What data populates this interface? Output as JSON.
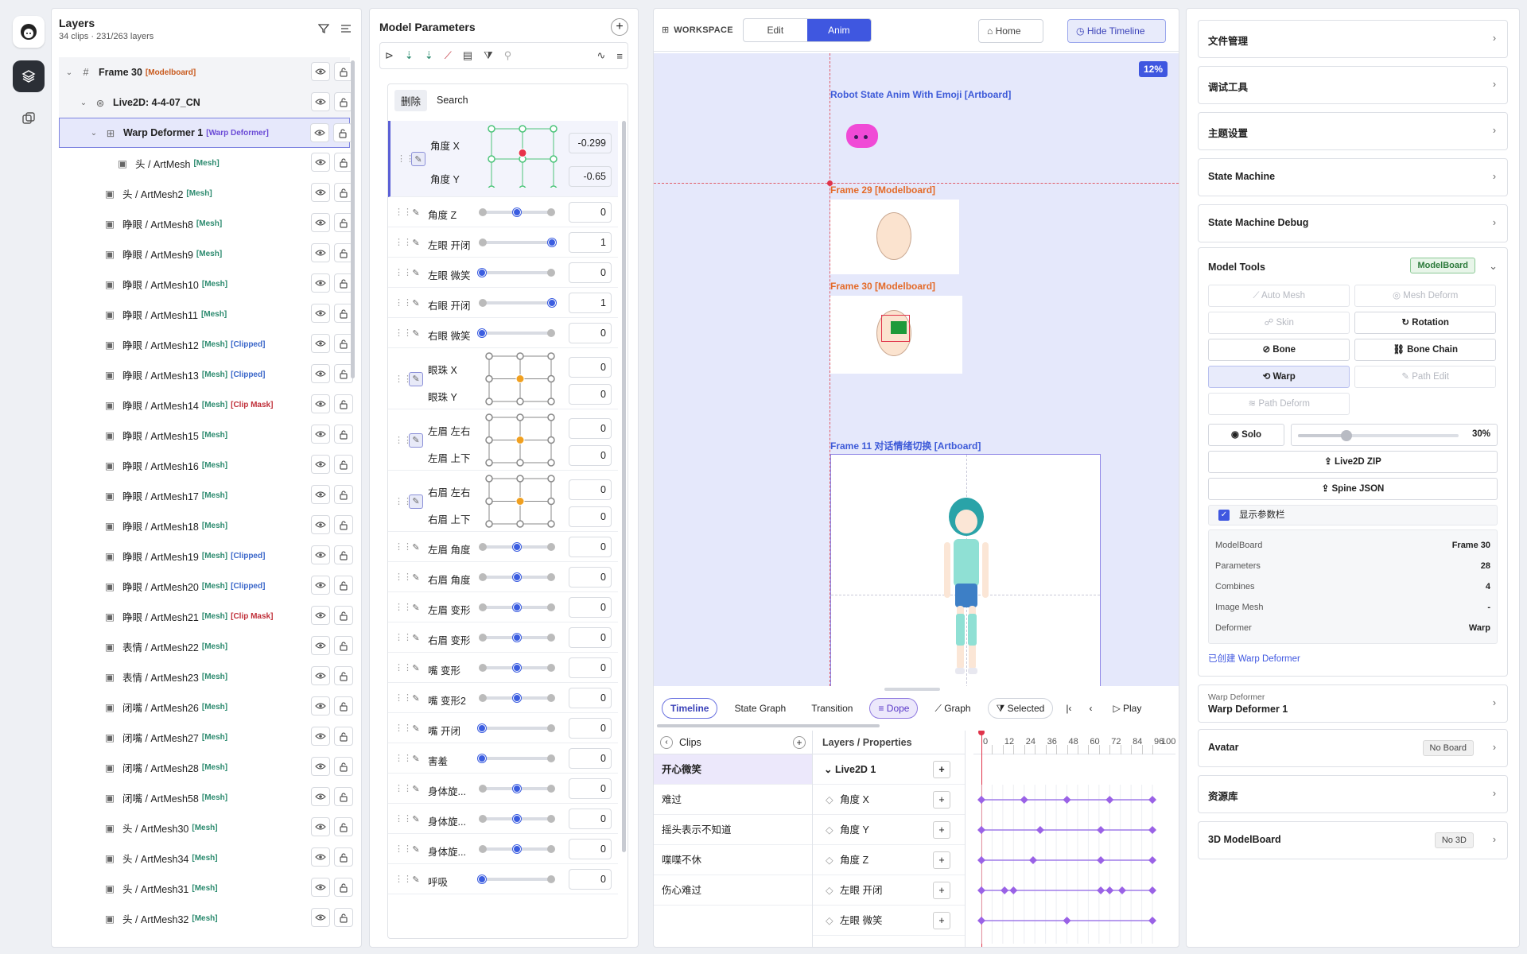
{
  "layers": {
    "title": "Layers",
    "subtitle": "34 clips · 231/263 layers",
    "rows": [
      {
        "name": "Frame 30",
        "tag": "[Modelboard]",
        "tag2": "",
        "kind": "frame",
        "indent": 0,
        "chev": "⌄"
      },
      {
        "name": "Live2D: 4-4-07_CN",
        "tag": "",
        "tag2": "",
        "kind": "l2d",
        "indent": 1,
        "chev": "⌄"
      },
      {
        "name": "Warp Deformer 1",
        "tag": "[Warp Deformer]",
        "tag2": "",
        "kind": "warp",
        "indent": 2,
        "chev": "⌄"
      },
      {
        "name": "头 / ArtMesh",
        "tag": "[Mesh]",
        "tag2": "",
        "kind": "mesh",
        "indent": 3,
        "chev": ""
      },
      {
        "name": "头 / ArtMesh2",
        "tag": "[Mesh]",
        "tag2": "",
        "kind": "mesh",
        "indent": 2,
        "chev": ""
      },
      {
        "name": "睁眼 / ArtMesh8",
        "tag": "[Mesh]",
        "tag2": "",
        "kind": "mesh",
        "indent": 2,
        "chev": ""
      },
      {
        "name": "睁眼 / ArtMesh9",
        "tag": "[Mesh]",
        "tag2": "",
        "kind": "mesh",
        "indent": 2,
        "chev": ""
      },
      {
        "name": "睁眼 / ArtMesh10",
        "tag": "[Mesh]",
        "tag2": "",
        "kind": "mesh",
        "indent": 2,
        "chev": ""
      },
      {
        "name": "睁眼 / ArtMesh11",
        "tag": "[Mesh]",
        "tag2": "",
        "kind": "mesh",
        "indent": 2,
        "chev": ""
      },
      {
        "name": "睁眼 / ArtMesh12",
        "tag": "[Mesh]",
        "tag2": "[Clipped]",
        "kind": "mesh",
        "indent": 2,
        "chev": ""
      },
      {
        "name": "睁眼 / ArtMesh13",
        "tag": "[Mesh]",
        "tag2": "[Clipped]",
        "kind": "mesh",
        "indent": 2,
        "chev": ""
      },
      {
        "name": "睁眼 / ArtMesh14",
        "tag": "[Mesh]",
        "tag2": "[Clip Mask]",
        "kind": "mesh",
        "indent": 2,
        "chev": ""
      },
      {
        "name": "睁眼 / ArtMesh15",
        "tag": "[Mesh]",
        "tag2": "",
        "kind": "mesh",
        "indent": 2,
        "chev": ""
      },
      {
        "name": "睁眼 / ArtMesh16",
        "tag": "[Mesh]",
        "tag2": "",
        "kind": "mesh",
        "indent": 2,
        "chev": ""
      },
      {
        "name": "睁眼 / ArtMesh17",
        "tag": "[Mesh]",
        "tag2": "",
        "kind": "mesh",
        "indent": 2,
        "chev": ""
      },
      {
        "name": "睁眼 / ArtMesh18",
        "tag": "[Mesh]",
        "tag2": "",
        "kind": "mesh",
        "indent": 2,
        "chev": ""
      },
      {
        "name": "睁眼 / ArtMesh19",
        "tag": "[Mesh]",
        "tag2": "[Clipped]",
        "kind": "mesh",
        "indent": 2,
        "chev": ""
      },
      {
        "name": "睁眼 / ArtMesh20",
        "tag": "[Mesh]",
        "tag2": "[Clipped]",
        "kind": "mesh",
        "indent": 2,
        "chev": ""
      },
      {
        "name": "睁眼 / ArtMesh21",
        "tag": "[Mesh]",
        "tag2": "[Clip Mask]",
        "kind": "mesh",
        "indent": 2,
        "chev": ""
      },
      {
        "name": "表情 / ArtMesh22",
        "tag": "[Mesh]",
        "tag2": "",
        "kind": "mesh",
        "indent": 2,
        "chev": ""
      },
      {
        "name": "表情 / ArtMesh23",
        "tag": "[Mesh]",
        "tag2": "",
        "kind": "mesh",
        "indent": 2,
        "chev": ""
      },
      {
        "name": "闭嘴 / ArtMesh26",
        "tag": "[Mesh]",
        "tag2": "",
        "kind": "mesh",
        "indent": 2,
        "chev": ""
      },
      {
        "name": "闭嘴 / ArtMesh27",
        "tag": "[Mesh]",
        "tag2": "",
        "kind": "mesh",
        "indent": 2,
        "chev": ""
      },
      {
        "name": "闭嘴 / ArtMesh28",
        "tag": "[Mesh]",
        "tag2": "",
        "kind": "mesh",
        "indent": 2,
        "chev": ""
      },
      {
        "name": "闭嘴 / ArtMesh58",
        "tag": "[Mesh]",
        "tag2": "",
        "kind": "mesh",
        "indent": 2,
        "chev": ""
      },
      {
        "name": "头 / ArtMesh30",
        "tag": "[Mesh]",
        "tag2": "",
        "kind": "mesh",
        "indent": 2,
        "chev": ""
      },
      {
        "name": "头 / ArtMesh34",
        "tag": "[Mesh]",
        "tag2": "",
        "kind": "mesh",
        "indent": 2,
        "chev": ""
      },
      {
        "name": "头 / ArtMesh31",
        "tag": "[Mesh]",
        "tag2": "",
        "kind": "mesh",
        "indent": 2,
        "chev": ""
      },
      {
        "name": "头 / ArtMesh32",
        "tag": "[Mesh]",
        "tag2": "",
        "kind": "mesh",
        "indent": 2,
        "chev": ""
      }
    ]
  },
  "params": {
    "title": "Model Parameters",
    "tab_delete": "删除",
    "tab_search": "Search",
    "rows": [
      {
        "type": "2d",
        "a": "角度 X",
        "b": "角度 Y",
        "va": "-0.299",
        "vb": "-0.65",
        "highlight": true,
        "h": 96,
        "dotx": 0.5,
        "doty": 0.4,
        "dotcolor": "#e8334a",
        "gridcolor": "#4cc47a"
      },
      {
        "type": "1d",
        "label": "角度 Z",
        "value": "0",
        "pos": 0.5
      },
      {
        "type": "1d",
        "label": "左眼 开闭",
        "value": "1",
        "pos": 1
      },
      {
        "type": "1d",
        "label": "左眼 微笑",
        "value": "0",
        "pos": 0
      },
      {
        "type": "1d",
        "label": "右眼 开闭",
        "value": "1",
        "pos": 1
      },
      {
        "type": "1d",
        "label": "右眼 微笑",
        "value": "0",
        "pos": 0
      },
      {
        "type": "2d",
        "a": "眼珠 X",
        "b": "眼珠 Y",
        "va": "0",
        "vb": "0",
        "highlight": false,
        "h": 77,
        "dotx": 0.5,
        "doty": 0.5,
        "dotcolor": "#f0a020",
        "gridcolor": "#888"
      },
      {
        "type": "2d",
        "a": "左眉 左右",
        "b": "左眉 上下",
        "va": "0",
        "vb": "0",
        "highlight": false,
        "h": 77,
        "dotx": 0.5,
        "doty": 0.5,
        "dotcolor": "#f0a020",
        "gridcolor": "#888"
      },
      {
        "type": "2d",
        "a": "右眉 左右",
        "b": "右眉 上下",
        "va": "0",
        "vb": "0",
        "highlight": false,
        "h": 77,
        "dotx": 0.5,
        "doty": 0.5,
        "dotcolor": "#f0a020",
        "gridcolor": "#888"
      },
      {
        "type": "1d",
        "label": "左眉 角度",
        "value": "0",
        "pos": 0.5
      },
      {
        "type": "1d",
        "label": "右眉 角度",
        "value": "0",
        "pos": 0.5
      },
      {
        "type": "1d",
        "label": "左眉 变形",
        "value": "0",
        "pos": 0.5
      },
      {
        "type": "1d",
        "label": "右眉 变形",
        "value": "0",
        "pos": 0.5
      },
      {
        "type": "1d",
        "label": "嘴 变形",
        "value": "0",
        "pos": 0.5
      },
      {
        "type": "1d",
        "label": "嘴 变形2",
        "value": "0",
        "pos": 0.5
      },
      {
        "type": "1d",
        "label": "嘴 开闭",
        "value": "0",
        "pos": 0
      },
      {
        "type": "1d",
        "label": "害羞",
        "value": "0",
        "pos": 0
      },
      {
        "type": "1d",
        "label": "身体旋...",
        "value": "0",
        "pos": 0.5
      },
      {
        "type": "1d",
        "label": "身体旋...",
        "value": "0",
        "pos": 0.5
      },
      {
        "type": "1d",
        "label": "身体旋...",
        "value": "0",
        "pos": 0.5
      },
      {
        "type": "1d",
        "label": "呼吸",
        "value": "0",
        "pos": 0
      }
    ]
  },
  "workspace": {
    "label": "WORKSPACE",
    "mode_edit": "Edit",
    "mode_anim": "Anim",
    "home": "Home",
    "hide_timeline": "Hide Timeline",
    "zoom": "12%",
    "artboards": {
      "robot": "Robot State Anim With Emoji [Artboard]",
      "frame29": "Frame 29 [Modelboard]",
      "frame30": "Frame 30 [Modelboard]",
      "frame11": "Frame 11 对话情绪切换 [Artboard]"
    }
  },
  "timeline": {
    "tabs": [
      "Timeline",
      "State Graph",
      "Transition"
    ],
    "dope": "Dope",
    "graph": "Graph",
    "selected": "Selected",
    "play": "Play",
    "clips_title": "Clips",
    "clips": [
      "开心微笑",
      "难过",
      "摇头表示不知道",
      "喋喋不休",
      "伤心难过"
    ],
    "layers_title": "Layers / Properties",
    "group": "Live2D 1",
    "props": [
      "角度 X",
      "角度 Y",
      "角度 Z",
      "左眼 开闭",
      "左眼 微笑"
    ],
    "ruler": [
      "0",
      "12",
      "24",
      "36",
      "48",
      "60",
      "72",
      "84",
      "96",
      "100"
    ],
    "keys": [
      [
        0,
        24,
        48,
        72,
        96
      ],
      [
        0,
        33,
        67,
        96
      ],
      [
        0,
        29,
        67,
        96
      ],
      [
        0,
        13,
        18,
        67,
        72,
        79,
        96
      ],
      [
        0,
        48,
        96
      ]
    ]
  },
  "right": {
    "sections_top": [
      "文件管理",
      "调试工具",
      "主题设置",
      "State Machine",
      "State Machine Debug"
    ],
    "model_tools": {
      "title": "Model Tools",
      "badge": "ModelBoard",
      "buttons": [
        {
          "label": "Auto Mesh",
          "state": "dim"
        },
        {
          "label": "Mesh Deform",
          "state": "dim"
        },
        {
          "label": "Skin",
          "state": "dim"
        },
        {
          "label": "Rotation",
          "state": "on"
        },
        {
          "label": "Bone",
          "state": "on"
        },
        {
          "label": "Bone Chain",
          "state": "on"
        },
        {
          "label": "Warp",
          "state": "blue"
        },
        {
          "label": "Path Edit",
          "state": "dim"
        },
        {
          "label": "Path Deform",
          "state": "dim"
        }
      ],
      "solo": "Solo",
      "opacity": "30%",
      "opacity_value": 0.3,
      "live2d_zip": "Live2D ZIP",
      "spine_json": "Spine JSON",
      "show_params": "显示参数栏",
      "info": [
        {
          "k": "ModelBoard",
          "v": "Frame 30"
        },
        {
          "k": "Parameters",
          "v": "28"
        },
        {
          "k": "Combines",
          "v": "4"
        },
        {
          "k": "Image Mesh",
          "v": "-"
        },
        {
          "k": "Deformer",
          "v": "Warp"
        }
      ],
      "created": "已创建 Warp Deformer"
    },
    "warp": {
      "caption": "Warp Deformer",
      "name": "Warp Deformer 1"
    },
    "avatar": {
      "label": "Avatar",
      "badge": "No Board"
    },
    "library": "资源库",
    "model3d": {
      "label": "3D ModelBoard",
      "badge": "No 3D"
    }
  }
}
